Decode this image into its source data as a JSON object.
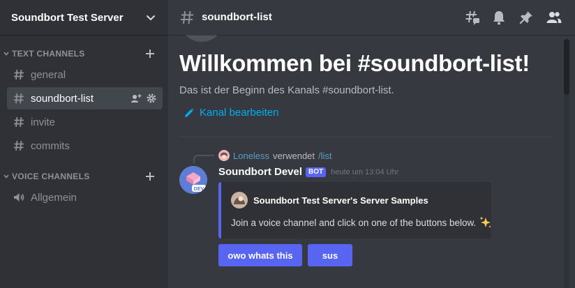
{
  "server": {
    "name": "Soundbort Test Server"
  },
  "categories": [
    {
      "label": "TEXT CHANNELS"
    },
    {
      "label": "VOICE CHANNELS"
    }
  ],
  "text_channels": [
    {
      "label": "general"
    },
    {
      "label": "soundbort-list"
    },
    {
      "label": "invite"
    },
    {
      "label": "commits"
    }
  ],
  "voice_channels": [
    {
      "label": "Allgemein"
    }
  ],
  "active_channel": "soundbort-list",
  "header": {
    "channel_name": "soundbort-list"
  },
  "welcome": {
    "title": "Willkommen bei #soundbort-list!",
    "subtitle": "Das ist der Beginn des Kanals #soundbort-list.",
    "edit_label": "Kanal bearbeiten"
  },
  "message": {
    "reply": {
      "user": "Loneless",
      "text": "verwendet",
      "command": "/list"
    },
    "author": "Soundbort Devel",
    "bot_tag": "BOT",
    "timestamp": "heute um 13:04 Uhr",
    "avatar_badge": "DEV",
    "embed": {
      "author": "Soundbort Test Server's Server Samples",
      "description": "Join a voice channel and click on one of the buttons below.",
      "accent_color": "#5865f2"
    },
    "buttons": [
      {
        "label": "owo whats this"
      },
      {
        "label": "sus"
      }
    ]
  },
  "icons": {
    "header": [
      "threads-icon",
      "bell-icon",
      "pin-icon",
      "members-icon"
    ],
    "channel_actions": [
      "invite-user-icon",
      "gear-icon"
    ]
  },
  "colors": {
    "sidebar_bg": "#2f3136",
    "main_bg": "#36393f",
    "blurple": "#5865f2",
    "link": "#00aff4"
  }
}
